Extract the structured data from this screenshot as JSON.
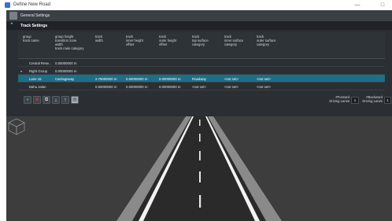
{
  "window": {
    "title": "Define New Road",
    "minimize_glyph": "—",
    "close_glyph": "□"
  },
  "topbar": {
    "label": "General Settings",
    "icon": "settings-icon"
  },
  "panel": {
    "title": "Track Settings",
    "collapse_glyph": "⌃"
  },
  "table": {
    "columns": [
      "group\ntrack name",
      "group height\ntransition zone\nwidth\ntrack main category",
      "track\nwidth",
      "track\ninner height\noffset",
      "track\nouter height\noffset",
      "track\ntop surface\ncategory",
      "track\ninner surface\ncategory",
      "track\nouter surface\ncategory"
    ],
    "rows": [
      {
        "name": "Central Rese...",
        "c1": "0.00000000 m",
        "c2": "",
        "c3": "",
        "c4": "",
        "c5": "",
        "c6": "",
        "c7": "",
        "caret": "",
        "selected": false
      },
      {
        "name": "Right Group",
        "c1": "0.00000000 m",
        "c2": "",
        "c3": "",
        "c4": "",
        "c5": "",
        "c6": "",
        "c7": "",
        "caret": "▾",
        "selected": false
      },
      {
        "name": "Lane 16",
        "c1": "Carriageway",
        "c2": "2.75000000 m",
        "c3": "0.00000000 m",
        "c4": "0.00000000 m",
        "c5": "Roadway",
        "c6": "<not set>",
        "c7": "<not set>",
        "caret": "",
        "selected": true
      },
      {
        "name": "Bahu Jalan",
        "c1": "",
        "c2": "0.50000000 m",
        "c3": "0.00000000 m",
        "c4": "0.00000000 m",
        "c5": "<not set>",
        "c6": "<not set>",
        "c7": "<not set>",
        "caret": "",
        "selected": false
      }
    ]
  },
  "toolbar": {
    "add_glyph": "+",
    "delete_glyph": "✕",
    "copy_glyph": "⧉",
    "down_glyph": "↓",
    "up_glyph": "↑",
    "paste_glyph": "▤",
    "add_color": "#4cc24c",
    "delete_color": "#e0453d"
  },
  "lanes": {
    "forward_label": "#Forward\nDriving Lanes",
    "forward_value": "1",
    "backward_label": "#Backward\nDriving Lanes",
    "backward_value": "1"
  },
  "colors": {
    "selected_row": "#1c6f86",
    "asphalt": "#2a2a2a",
    "ground": "#3d3d3d",
    "lane_marking": "#f2f2f2"
  }
}
